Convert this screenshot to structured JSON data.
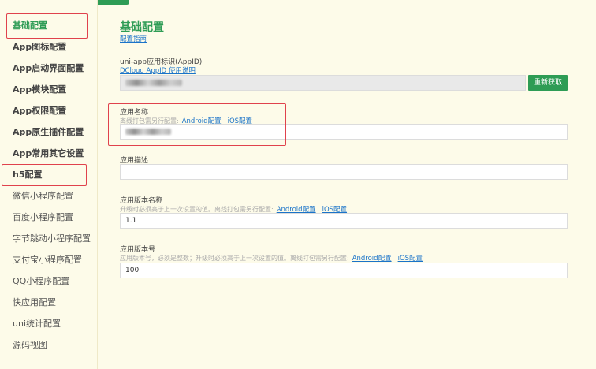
{
  "top_tabs": [
    "",
    ""
  ],
  "sidebar": {
    "items": [
      {
        "label": "基础配置"
      },
      {
        "label": "App图标配置"
      },
      {
        "label": "App启动界面配置"
      },
      {
        "label": "App模块配置"
      },
      {
        "label": "App权限配置"
      },
      {
        "label": "App原生插件配置"
      },
      {
        "label": "App常用其它设置"
      },
      {
        "label": "h5配置"
      },
      {
        "label": "微信小程序配置"
      },
      {
        "label": "百度小程序配置"
      },
      {
        "label": "字节跳动小程序配置"
      },
      {
        "label": "支付宝小程序配置"
      },
      {
        "label": "QQ小程序配置"
      },
      {
        "label": "快应用配置"
      },
      {
        "label": "uni统计配置"
      },
      {
        "label": "源码视图"
      }
    ]
  },
  "main": {
    "title": "基础配置",
    "guide_link": "配置指南",
    "appid": {
      "label": "uni-app应用标识(AppID)",
      "help_link": "DCloud AppID 使用说明",
      "refresh_button": "重新获取"
    },
    "app_name": {
      "label": "应用名称",
      "hint": "离线打包需另行配置:",
      "android_link": "Android配置",
      "ios_link": "iOS配置"
    },
    "app_desc": {
      "label": "应用描述",
      "value": ""
    },
    "version_name": {
      "label": "应用版本名称",
      "hint": "升级时必须高于上一次设置的值。离线打包需另行配置:",
      "android_link": "Android配置",
      "ios_link": "iOS配置",
      "value": "1.1"
    },
    "version_code": {
      "label": "应用版本号",
      "hint": "应用版本号，必须是整数；升级时必须高于上一次设置的值。离线打包需另行配置:",
      "android_link": "Android配置",
      "ios_link": "iOS配置",
      "value": "100"
    }
  },
  "colors": {
    "accent": "#2e9c55",
    "highlight_box": "#e0424d",
    "link": "#1a73c9",
    "background": "#fdfbe9"
  }
}
